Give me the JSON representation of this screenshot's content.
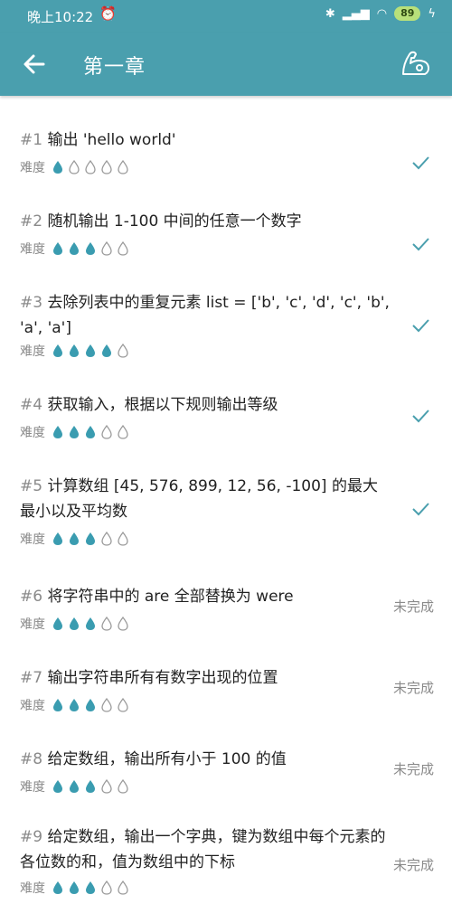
{
  "status_bar": {
    "time": "晚上10:22",
    "battery": "89"
  },
  "app_bar": {
    "title": "第一章"
  },
  "difficulty_label": "难度",
  "colors": {
    "accent": "#4a9fae",
    "drop_filled": "#3a9cb0",
    "check": "#4a9fae"
  },
  "icons": {
    "back": "arrow-left-icon",
    "action": "flexed-arm-icon",
    "done": "checkmark-icon",
    "drop": "water-drop-icon"
  },
  "items": [
    {
      "num": "#1",
      "title": "输出 'hello world'",
      "difficulty": 1,
      "status": "done",
      "status_text": ""
    },
    {
      "num": "#2",
      "title": "随机输出 1-100 中间的任意一个数字",
      "difficulty": 3,
      "status": "done",
      "status_text": ""
    },
    {
      "num": "#3",
      "title": "去除列表中的重复元素 list = ['b', 'c', 'd', 'c', 'b', 'a', 'a']",
      "difficulty": 4,
      "status": "done",
      "status_text": ""
    },
    {
      "num": "#4",
      "title": "获取输入，根据以下规则输出等级",
      "difficulty": 3,
      "status": "done",
      "status_text": ""
    },
    {
      "num": "#5",
      "title": "计算数组 [45, 576, 899, 12, 56, -100] 的最大最小以及平均数",
      "difficulty": 3,
      "status": "done",
      "status_text": ""
    },
    {
      "num": "#6",
      "title": "将字符串中的 are 全部替换为 were",
      "difficulty": 3,
      "status": "todo",
      "status_text": "未完成"
    },
    {
      "num": "#7",
      "title": "输出字符串所有有数字出现的位置",
      "difficulty": 3,
      "status": "todo",
      "status_text": "未完成"
    },
    {
      "num": "#8",
      "title": "给定数组，输出所有小于 100 的值",
      "difficulty": 3,
      "status": "todo",
      "status_text": "未完成"
    },
    {
      "num": "#9",
      "title": "给定数组，输出一个字典，键为数组中每个元素的各位数的和，值为数组中的下标",
      "difficulty": 3,
      "status": "todo",
      "status_text": "未完成"
    }
  ]
}
